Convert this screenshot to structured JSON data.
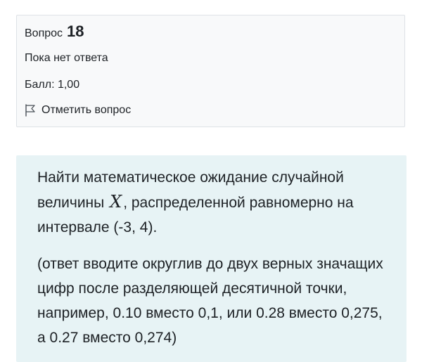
{
  "question_info": {
    "prefix": "Вопрос",
    "number": "18",
    "state": "Пока нет ответа",
    "grade": "Балл: 1,00",
    "flag_label": "Отметить вопрос",
    "flag_icon": "flag-outline-icon"
  },
  "question_text": {
    "line1_before": "Найти математическое ожидание случайной величины ",
    "variable": "X",
    "line1_after": ", распределенной равномерно на интервале (-3, 4).",
    "instructions": "(ответ вводите округлив до двух верных значащих цифр после разделяющей десятичной точки, например, 0.10 вместо 0,1, или 0.28 вместо 0,275, а 0.27 вместо 0,274)"
  },
  "colors": {
    "info_bg": "#f8f9fa",
    "info_border": "#dee2e6",
    "content_bg": "#e7f3f5",
    "text": "#1d2125"
  }
}
